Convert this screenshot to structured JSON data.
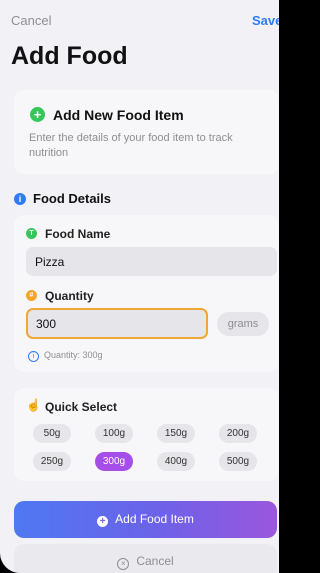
{
  "nav": {
    "cancel": "Cancel",
    "save": "Save"
  },
  "title": "Add Food",
  "intro": {
    "icon": "plus-circle-icon",
    "heading": "Add New Food Item",
    "description": "Enter the details of your food item to track nutrition"
  },
  "details_section": {
    "icon": "info-icon",
    "title": "Food Details"
  },
  "food_name": {
    "label": "Food Name",
    "value": "Pizza",
    "icon": "text-icon"
  },
  "quantity": {
    "label": "Quantity",
    "value": "300",
    "unit": "grams",
    "info": "Quantity: 300g",
    "icon": "scale-icon"
  },
  "quick_select": {
    "title": "Quick Select",
    "icon": "tap-hand-icon",
    "options": [
      "50g",
      "100g",
      "150g",
      "200g",
      "250g",
      "300g",
      "400g",
      "500g"
    ],
    "selected": "300g"
  },
  "actions": {
    "add": "Add Food Item",
    "cancel": "Cancel"
  },
  "colors": {
    "accent": "#2f7bf6",
    "quantity_border": "#f0a73a",
    "selected_chip": "#a54ee8",
    "green": "#35c759"
  }
}
